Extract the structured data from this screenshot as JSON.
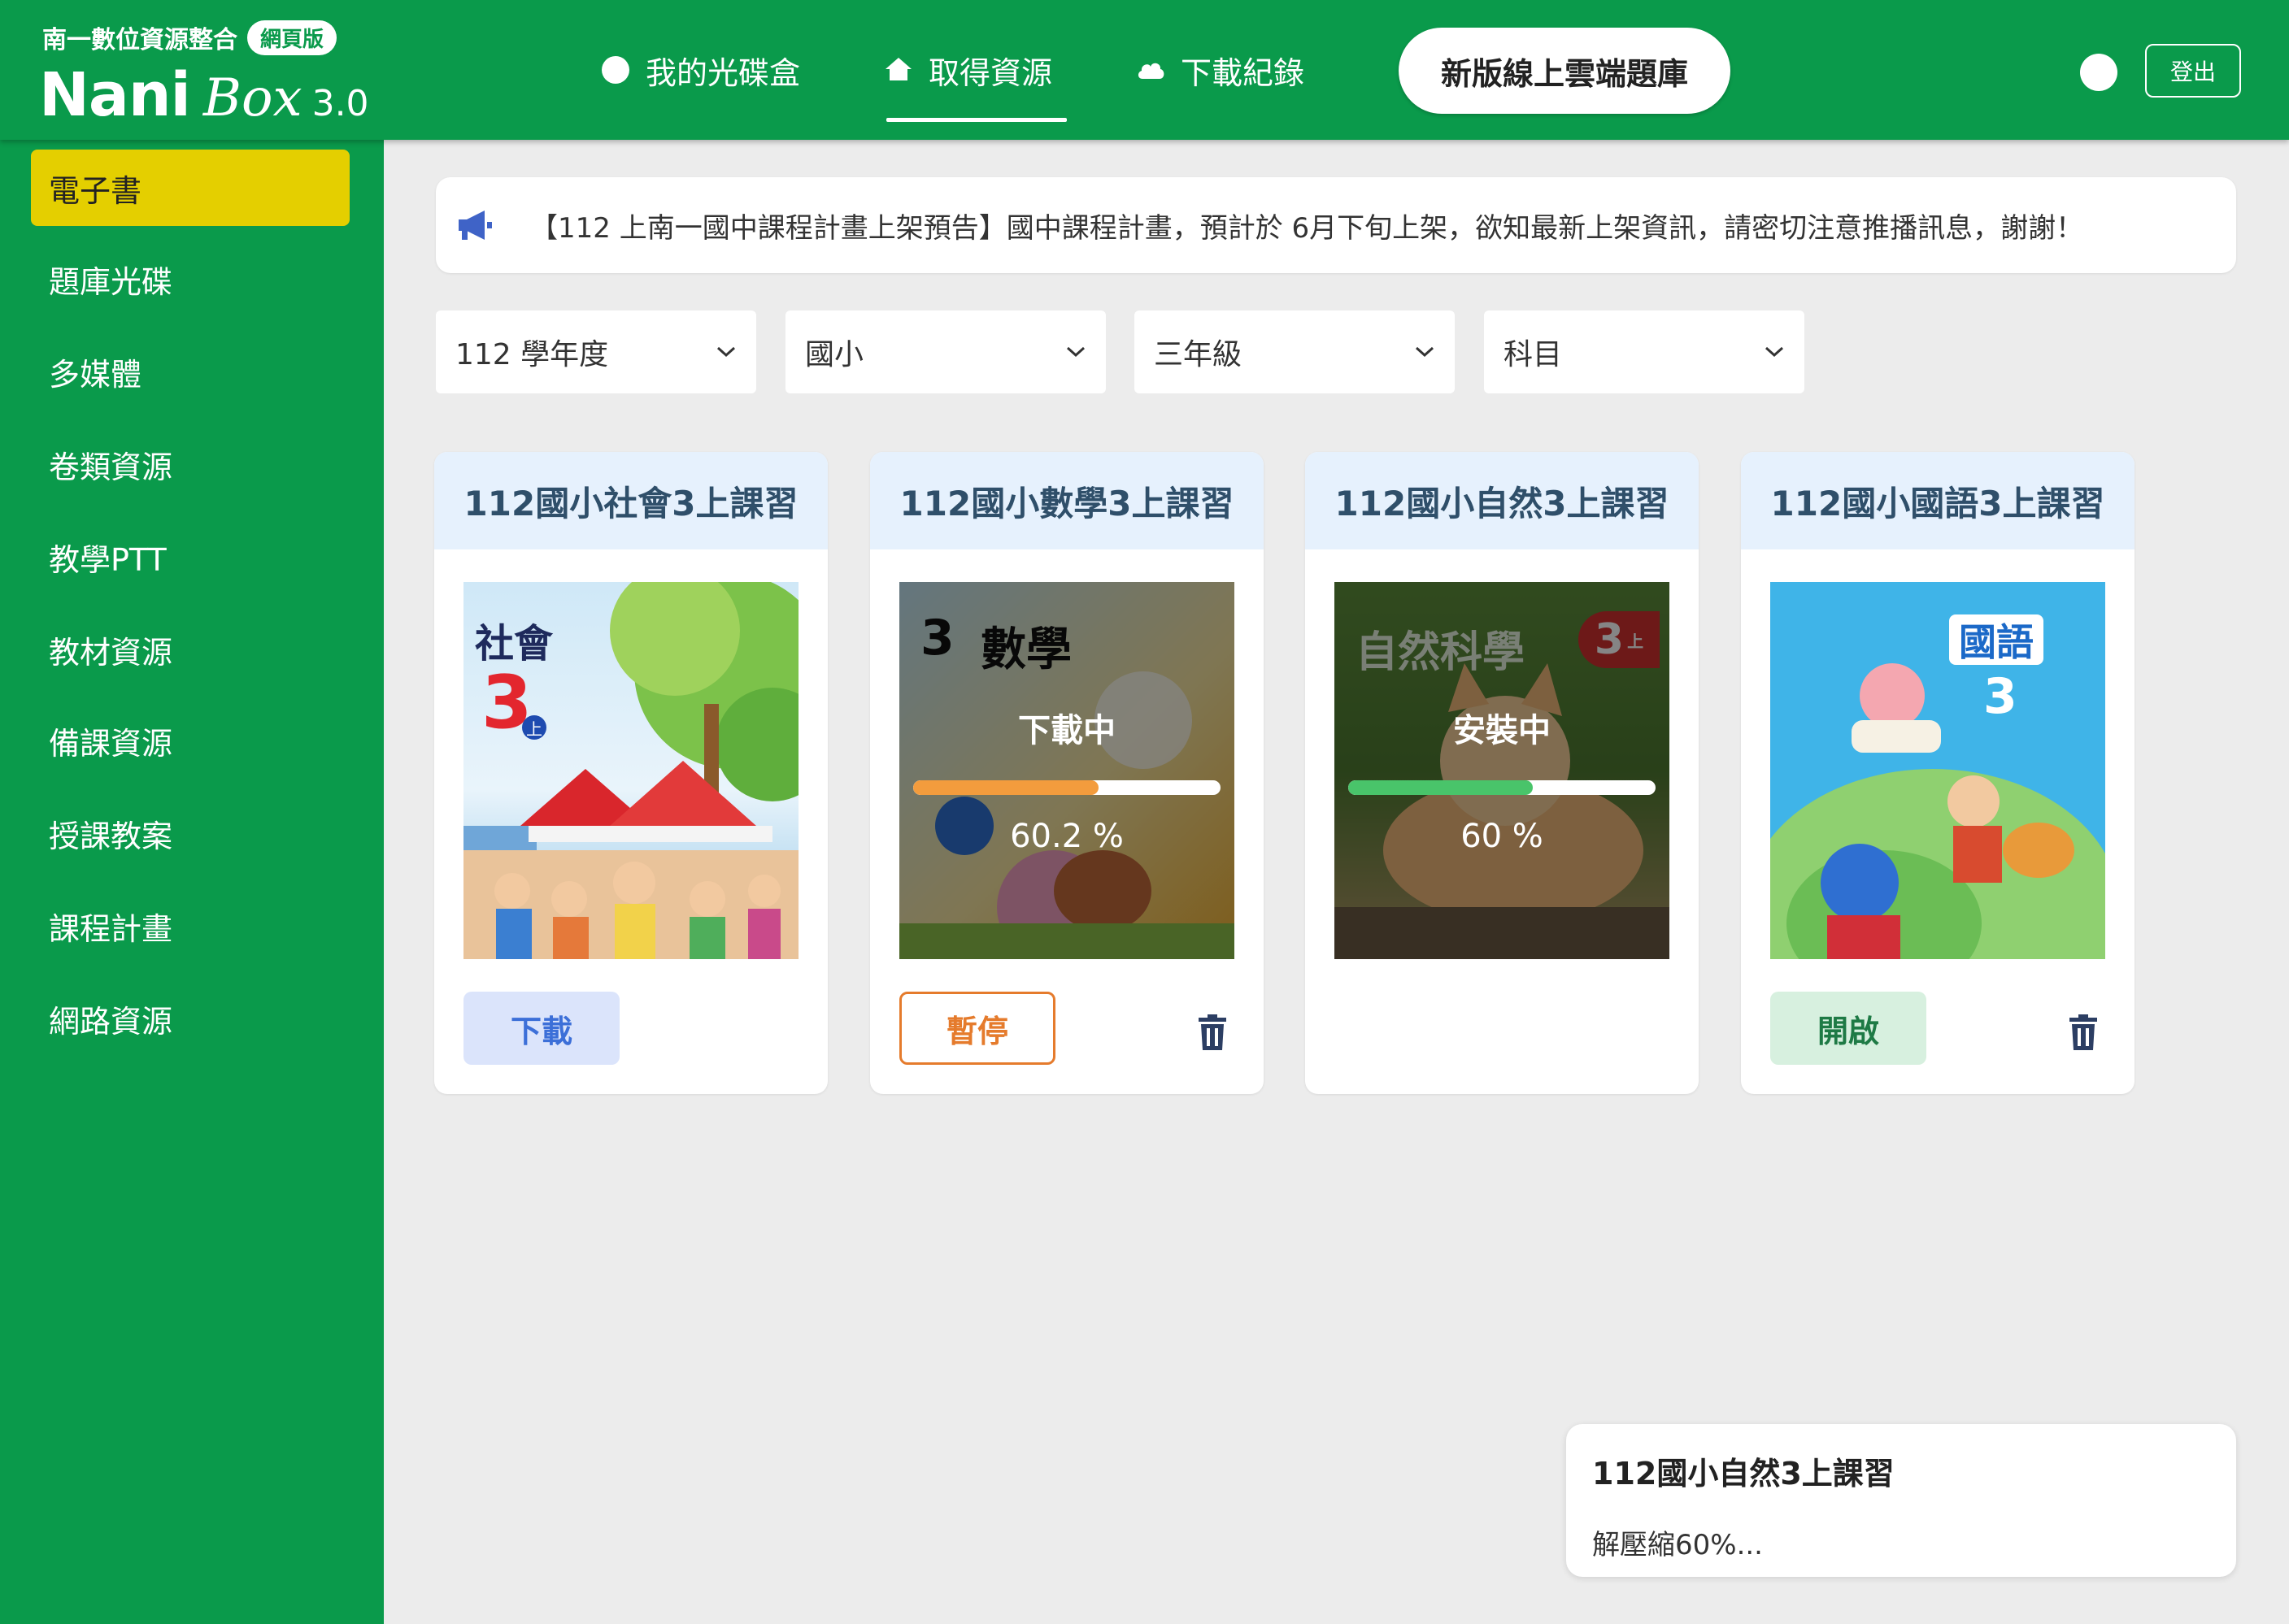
{
  "brand": {
    "title": "南一數位資源整合",
    "badge": "網頁版",
    "logo_main": "Nani",
    "logo_box": "Box",
    "logo_version": "3.0"
  },
  "nav": {
    "items": [
      {
        "label": "我的光碟盒",
        "icon": "circle-icon"
      },
      {
        "label": "取得資源",
        "icon": "home-icon",
        "active": true
      },
      {
        "label": "下載紀錄",
        "icon": "cloud-icon"
      }
    ],
    "cloud_button": "新版線上雲端題庫",
    "logout": "登出"
  },
  "sidebar": {
    "items": [
      {
        "label": "電子書",
        "active": true
      },
      {
        "label": "題庫光碟"
      },
      {
        "label": "多媒體"
      },
      {
        "label": "卷類資源"
      },
      {
        "label": "教學PTT"
      },
      {
        "label": "教材資源"
      },
      {
        "label": "備課資源"
      },
      {
        "label": "授課教案"
      },
      {
        "label": "課程計畫"
      },
      {
        "label": "網路資源"
      }
    ]
  },
  "announcement": {
    "text": "【112 上南一國中課程計畫上架預告】國中課程計畫，預計於 6月下旬上架，欲知最新上架資訊，請密切注意推播訊息，謝謝！",
    "icon": "megaphone-icon"
  },
  "filters": [
    {
      "value": "112 學年度"
    },
    {
      "value": "國小"
    },
    {
      "value": "三年級"
    },
    {
      "value": "科目"
    }
  ],
  "cards": [
    {
      "title": "112國小社會3上課習",
      "cover_text": "社會",
      "cover_grade": "3",
      "cover_grade_mark": "上",
      "state": "idle",
      "button": "下載"
    },
    {
      "title": "112國小數學3上課習",
      "cover_text": "數學",
      "cover_grade": "3",
      "state": "downloading",
      "status_label": "下載中",
      "progress": 60.2,
      "progress_text": "60.2 %",
      "progress_color": "#f39c3d",
      "button": "暫停"
    },
    {
      "title": "112國小自然3上課習",
      "cover_text": "自然科學",
      "cover_grade": "3",
      "cover_grade_mark": "上",
      "state": "installing",
      "status_label": "安裝中",
      "progress": 60,
      "progress_text": "60 %",
      "progress_color": "#49c46a"
    },
    {
      "title": "112國小國語3上課習",
      "cover_text": "國語",
      "cover_grade": "3",
      "state": "installed",
      "button": "開啟"
    }
  ],
  "toast": {
    "title": "112國小自然3上課習",
    "message": "解壓縮60%..."
  },
  "colors": {
    "brand_green": "#0a9a4b",
    "active_yellow": "#e4cf00",
    "card_title_bg": "#e6f1fd"
  }
}
